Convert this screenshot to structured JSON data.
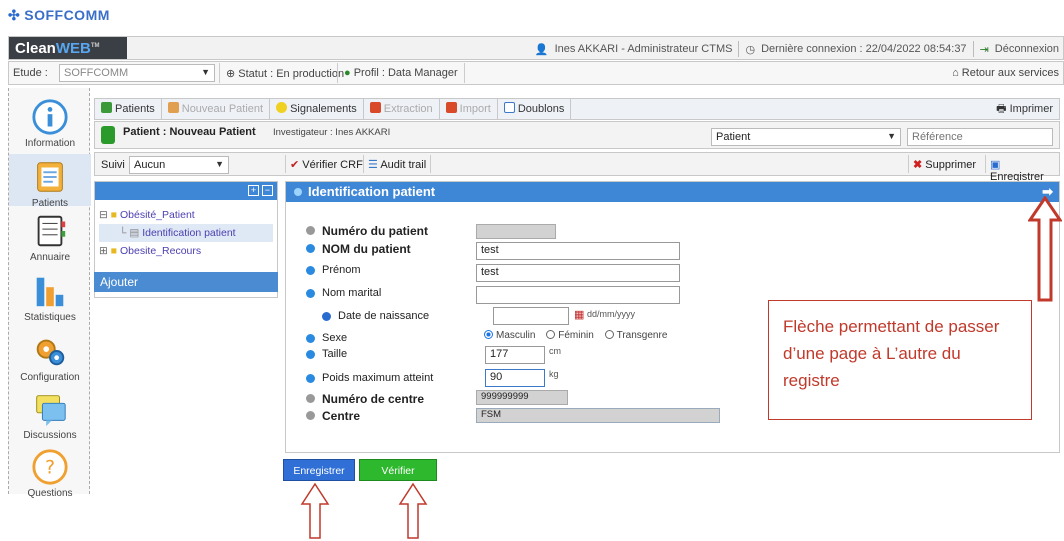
{
  "logo": {
    "text": "SOFFCOMM"
  },
  "app": {
    "brand_a": "Clean",
    "brand_b": "WEB",
    "brand_tm": "TM"
  },
  "topbar": {
    "user": "Ines AKKARI - Administrateur CTMS",
    "last_login": "Dernière connexion : 22/04/2022 08:54:37",
    "logout": "Déconnexion"
  },
  "etudebar": {
    "etude_label": "Etude :",
    "etude_value": "SOFFCOMM",
    "statut": "Statut : En production",
    "profil": "Profil : Data Manager",
    "retour": "Retour aux services"
  },
  "nav": {
    "items": [
      {
        "label": "Information"
      },
      {
        "label": "Patients"
      },
      {
        "label": "Annuaire"
      },
      {
        "label": "Statistiques"
      },
      {
        "label": "Configuration"
      },
      {
        "label": "Discussions"
      },
      {
        "label": "Questions"
      }
    ]
  },
  "toolbar": {
    "patients": "Patients",
    "nouveau": "Nouveau Patient",
    "signalements": "Signalements",
    "extraction": "Extraction",
    "import": "Import",
    "doublons": "Doublons",
    "imprimer": "Imprimer"
  },
  "patientbar": {
    "title": "Patient : Nouveau Patient",
    "investigateur": "Investigateur : Ines AKKARI",
    "select_value": "Patient",
    "reference_placeholder": "Référence"
  },
  "suivibar": {
    "suivi_label": "Suivi",
    "suivi_value": "Aucun",
    "verifier_crf": "Vérifier CRF",
    "audit": "Audit trail",
    "supprimer": "Supprimer",
    "enregistrer": "Enregistrer"
  },
  "tree": {
    "root1": "Obésité_Patient",
    "child": "Identification patient",
    "root2": "Obesite_Recours",
    "ajouter": "Ajouter"
  },
  "form": {
    "header": "Identification patient",
    "numero_label": "Numéro du patient",
    "nom_label": "NOM du patient",
    "nom_value": "test",
    "prenom_label": "Prénom",
    "prenom_value": "test",
    "nom_marital_label": "Nom marital",
    "naissance_label": "Date de naissance",
    "naissance_format": "dd/mm/yyyy",
    "sexe_label": "Sexe",
    "sexe_options": [
      "Masculin",
      "Féminin",
      "Transgenre"
    ],
    "sexe_selected": "Masculin",
    "taille_label": "Taille",
    "taille_value": "177",
    "taille_unit": "cm",
    "poids_label": "Poids maximum atteint",
    "poids_value": "90",
    "poids_unit": "kg",
    "num_centre_label": "Numéro de centre",
    "num_centre_value": "999999999",
    "centre_label": "Centre",
    "centre_value": "FSM"
  },
  "buttons": {
    "enregistrer": "Enregistrer",
    "verifier": "Vérifier"
  },
  "annotation": {
    "text": "Flèche permettant de passer d’une page à L’autre du registre"
  },
  "colors": {
    "accent": "#3e86d6",
    "save": "#2f6fd6",
    "verify": "#2eb82e",
    "annotation": "#c0392b"
  }
}
